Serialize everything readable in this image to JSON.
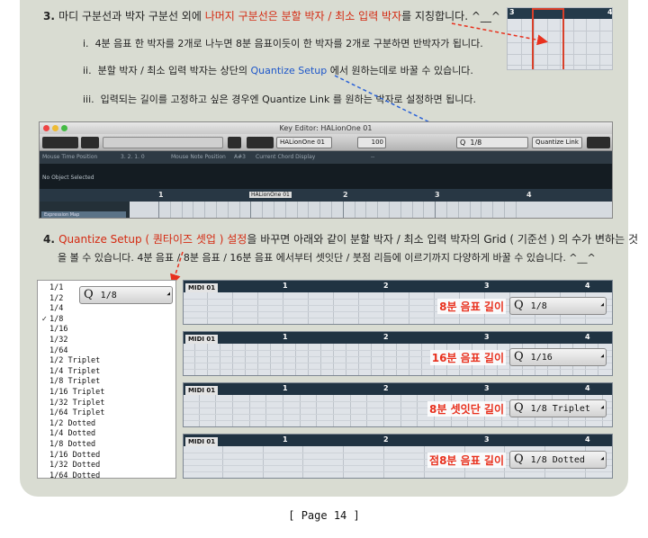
{
  "items": {
    "item3": {
      "num": "3.",
      "pre": "마디 구분선과 박자 구분선 외에 ",
      "red": "나머지 구분선은 분할 박자 / 최소 입력 박자",
      "post": "를 지칭합니다. ^__^"
    },
    "sub_i": {
      "num": "i.",
      "text": "4분 음표 한 박자를 2개로 나누면 8분 음표이듯이 한 박자를 2개로 구분하면 반박자가 됩니다."
    },
    "sub_ii": {
      "num": "ii.",
      "pre": "분할 박자 / 최소 입력 박자는 상단의 ",
      "blue": "Quantize Setup",
      "post": " 에서 원하는데로 바꿀 수 있습니다."
    },
    "sub_iii": {
      "num": "iii.",
      "text": "입력되는 길이를 고정하고 싶은 경우엔 Quantize Link 를 원하는 박자로 설정하면 됩니다."
    },
    "item4": {
      "num": "4.",
      "red": "Quantize Setup ( 퀀타이즈 셋업 ) 설정",
      "post": "을 바꾸면 아래와 같이 분할 박자 / 최소 입력 박자의 Grid ( 기준선 ) 의 수가 변하는 것",
      "line2": "을 볼 수 있습니다. 4분 음표 / 8분 음표 / 16분 음표 에서부터 셋잇단 / 붓점 리듬에 이르기까지 다양하게 바꿀 수 있습니다. ^__^"
    }
  },
  "mini_grid": {
    "labels": [
      "3",
      "4"
    ]
  },
  "key_editor": {
    "title": "Key Editor: HALionOne 01",
    "track_select": "HALionOne 01",
    "value_100": "100",
    "quantize": "1/8",
    "quantize_link": "Quantize Link",
    "info": [
      "Mouse Time Position",
      "3. 2. 1. 0",
      "Mouse Note Position",
      "A#3",
      "Current Chord Display",
      "--"
    ],
    "status": "No Object Selected",
    "ruler": [
      "1",
      "2",
      "3",
      "4"
    ],
    "part_name": "HALionOne 01",
    "lane_label": "Expression Map"
  },
  "quantize_list": {
    "selected": "1/8",
    "check": "✓",
    "items": [
      "1/1",
      "1/2",
      "1/4",
      "1/8",
      "1/16",
      "1/32",
      "1/64",
      "1/2  Triplet",
      "1/4  Triplet",
      "1/8  Triplet",
      "1/16  Triplet",
      "1/32  Triplet",
      "1/64  Triplet",
      "1/2  Dotted",
      "1/4  Dotted",
      "1/8  Dotted",
      "1/16  Dotted",
      "1/32  Dotted",
      "1/64  Dotted"
    ],
    "box_value": "1/8"
  },
  "strips": [
    {
      "name": "MIDI 01",
      "label": "8분 음표 길이",
      "q": "1/8",
      "ruler": [
        "1",
        "2",
        "3",
        "4"
      ],
      "subdiv": 8
    },
    {
      "name": "MIDI 01",
      "label": "16분 음표 길이",
      "q": "1/16",
      "ruler": [
        "1",
        "2",
        "3",
        "4"
      ],
      "subdiv": 16
    },
    {
      "name": "MIDI 01",
      "label": "8분 셋잇단 길이",
      "q": "1/8  Triplet",
      "ruler": [
        "1",
        "2",
        "3",
        "4"
      ],
      "subdiv": 12
    },
    {
      "name": "MIDI 01",
      "label": "점8분 음표 길이",
      "q": "1/8  Dotted",
      "ruler": [
        "1",
        "2",
        "3",
        "4"
      ],
      "subdiv": 5
    }
  ],
  "q_symbol": "Q",
  "footer": "[ Page 14 ]",
  "colors": {
    "red": "#d42a12",
    "blue": "#1d56c9",
    "panel": "#d9dcd2"
  }
}
